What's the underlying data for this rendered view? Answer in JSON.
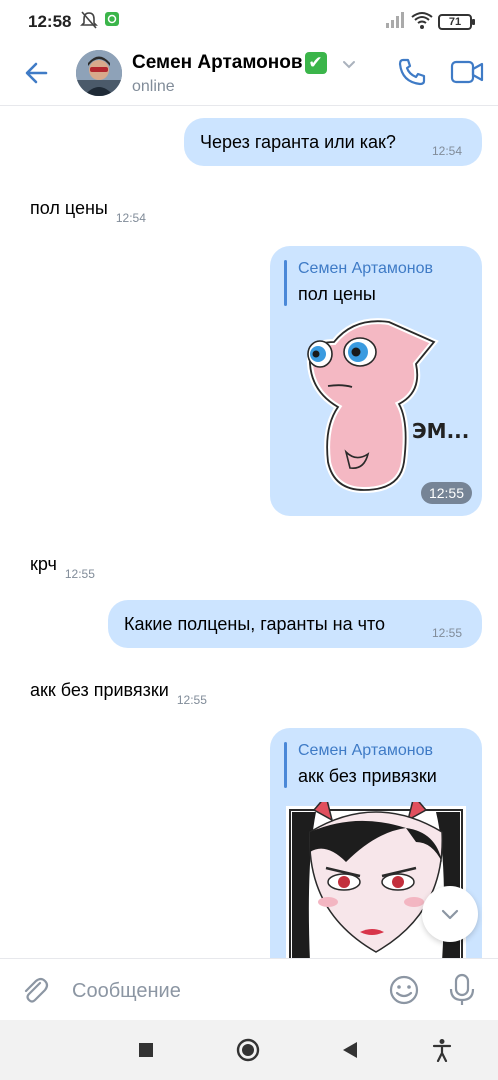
{
  "status_bar": {
    "time": "12:58",
    "battery": "71"
  },
  "header": {
    "contact_name": "Семен Артамонов",
    "verified_mark": "✔",
    "status": "online"
  },
  "messages": [
    {
      "direction": "out",
      "text": "Через гаранта или как?",
      "time": "12:54"
    },
    {
      "direction": "in",
      "text": "пол цены",
      "time": "12:54"
    },
    {
      "direction": "out",
      "type": "sticker",
      "reply_author": "Семен Артамонов",
      "reply_text": "пол цены",
      "sticker_caption": "ЭМ...",
      "time": "12:55"
    },
    {
      "direction": "in",
      "text": "крч",
      "time": "12:55"
    },
    {
      "direction": "out",
      "text": "Какие полцены, гаранты на что",
      "time": "12:55"
    },
    {
      "direction": "in",
      "text": "акк без привязки",
      "time": "12:55"
    },
    {
      "direction": "out",
      "type": "sticker",
      "reply_author": "Семен Артамонов",
      "reply_text": "акк без привязки"
    }
  ],
  "composer": {
    "placeholder": "Сообщение"
  },
  "colors": {
    "accent": "#3f7bc6",
    "outgoing_bubble": "#cce4ff",
    "time_gray": "#818c99"
  },
  "icons": {
    "back": "arrow-left-icon",
    "call": "phone-icon",
    "video": "video-camera-icon",
    "attach": "paperclip-icon",
    "emoji": "smile-icon",
    "mic": "microphone-icon",
    "scroll": "chevron-down-icon"
  }
}
